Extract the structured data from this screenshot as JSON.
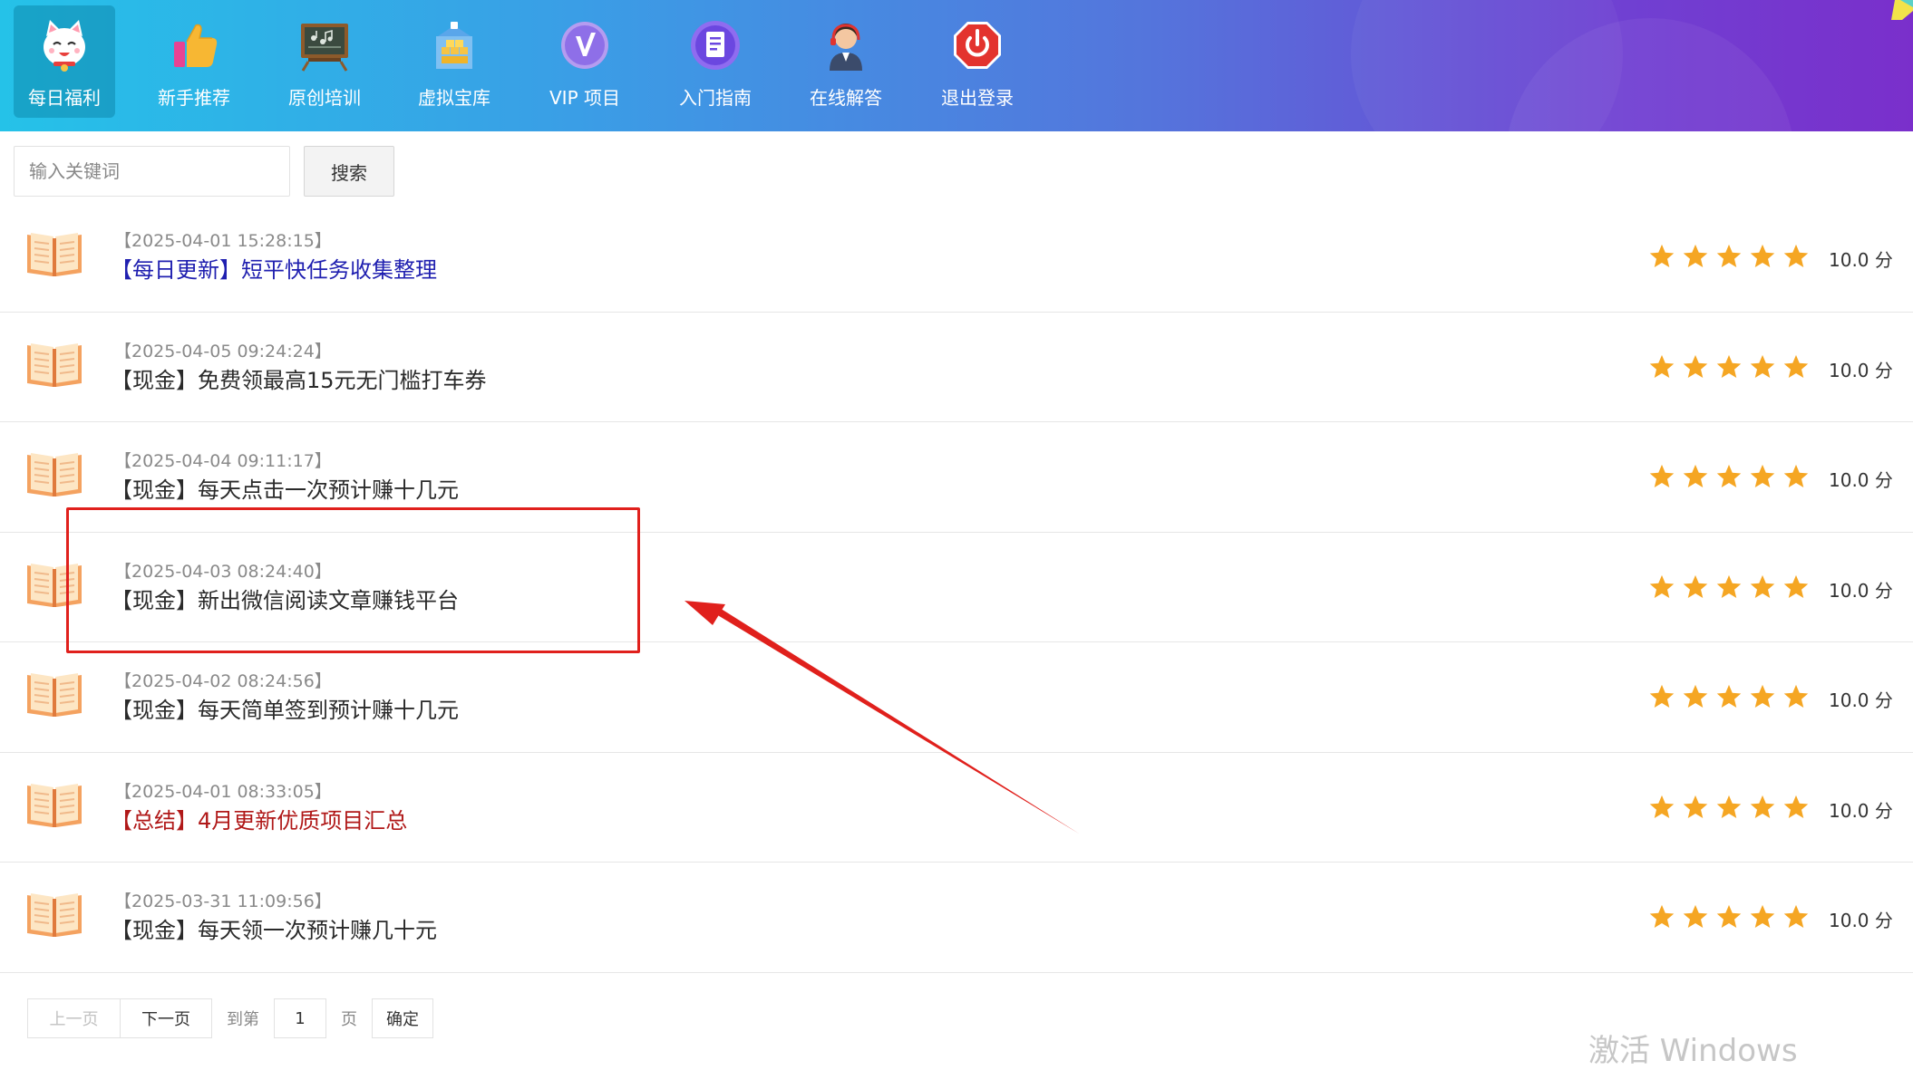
{
  "nav": {
    "items": [
      {
        "label": "每日福利",
        "icon": "lucky-cat-icon",
        "active": true
      },
      {
        "label": "新手推荐",
        "icon": "thumbs-up-icon",
        "active": false
      },
      {
        "label": "原创培训",
        "icon": "chalkboard-icon",
        "active": false
      },
      {
        "label": "虚拟宝库",
        "icon": "treasure-box-icon",
        "active": false
      },
      {
        "label": "VIP 项目",
        "icon": "vip-badge-icon",
        "active": false
      },
      {
        "label": "入门指南",
        "icon": "guide-document-icon",
        "active": false
      },
      {
        "label": "在线解答",
        "icon": "support-agent-icon",
        "active": false
      },
      {
        "label": "退出登录",
        "icon": "power-off-icon",
        "active": false
      }
    ]
  },
  "search": {
    "placeholder": "输入关键词",
    "button_label": "搜索"
  },
  "list": {
    "items": [
      {
        "date": "【2025-04-01 15:28:15】",
        "title": "【每日更新】短平快任务收集整理",
        "color": "#2020b0",
        "stars": 5,
        "score": "10.0 分"
      },
      {
        "date": "【2025-04-05 09:24:24】",
        "title": "【现金】免费领最高15元无门槛打车券",
        "color": "#2a2a2a",
        "stars": 5,
        "score": "10.0 分"
      },
      {
        "date": "【2025-04-04 09:11:17】",
        "title": "【现金】每天点击一次预计赚十几元",
        "color": "#2a2a2a",
        "stars": 5,
        "score": "10.0 分"
      },
      {
        "date": "【2025-04-03 08:24:40】",
        "title": "【现金】新出微信阅读文章赚钱平台",
        "color": "#2a2a2a",
        "stars": 5,
        "score": "10.0 分"
      },
      {
        "date": "【2025-04-02 08:24:56】",
        "title": "【现金】每天简单签到预计赚十几元",
        "color": "#2a2a2a",
        "stars": 5,
        "score": "10.0 分"
      },
      {
        "date": "【2025-04-01 08:33:05】",
        "title": "【总结】4月更新优质项目汇总",
        "color": "#b01818",
        "stars": 5,
        "score": "10.0 分"
      },
      {
        "date": "【2025-03-31 11:09:56】",
        "title": "【现金】每天领一次预计赚几十元",
        "color": "#2a2a2a",
        "stars": 5,
        "score": "10.0 分"
      }
    ],
    "item_icon": "open-book-icon",
    "star_color": "#f5a623"
  },
  "annotation": {
    "highlighted_item": 4,
    "color": "#e0201c"
  },
  "pagination": {
    "prev_label": "上一页",
    "next_label": "下一页",
    "goto_label": "到第",
    "page_value": "1",
    "page_unit": "页",
    "confirm_label": "确定"
  },
  "watermark": "激活 Windows"
}
